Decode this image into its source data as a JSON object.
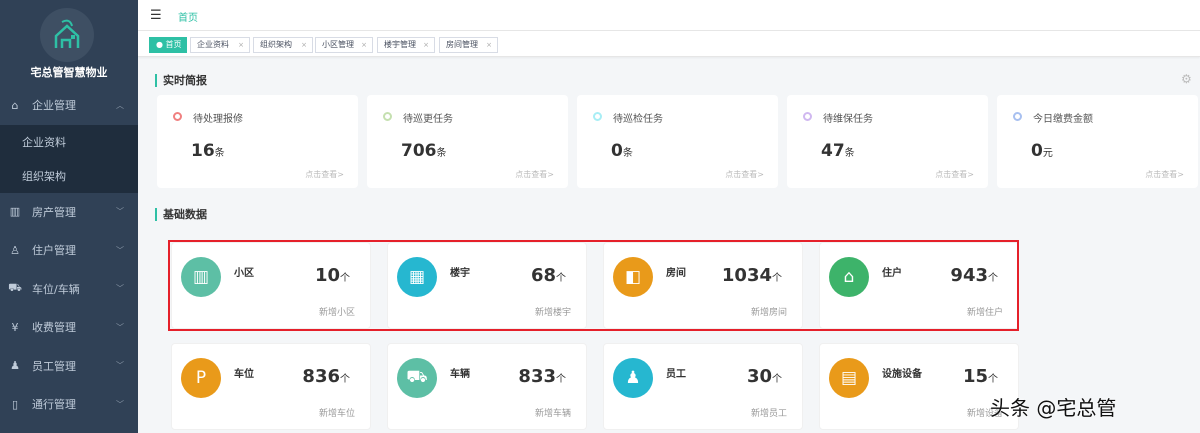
{
  "sidebar": {
    "brand": "宅总管智慧物业",
    "items": [
      {
        "label": "企业管理",
        "icon": "home-icon",
        "expanded": true
      },
      {
        "label": "房产管理",
        "icon": "building-icon"
      },
      {
        "label": "住户管理",
        "icon": "user-icon"
      },
      {
        "label": "车位/车辆",
        "icon": "car-icon"
      },
      {
        "label": "收费管理",
        "icon": "money-icon"
      },
      {
        "label": "员工管理",
        "icon": "staff-icon"
      },
      {
        "label": "通行管理",
        "icon": "door-icon"
      }
    ],
    "subitems": [
      "企业资料",
      "组织架构"
    ]
  },
  "header": {
    "breadcrumb": "首页"
  },
  "tabs": [
    {
      "label": "首页"
    },
    {
      "label": "企业资料"
    },
    {
      "label": "组织架构"
    },
    {
      "label": "小区管理"
    },
    {
      "label": "楼宇管理"
    },
    {
      "label": "房间管理"
    }
  ],
  "realtime": {
    "title": "实时简报",
    "link": "点击查看>",
    "cards": [
      {
        "label": "待处理报修",
        "value": "16",
        "unit": "条",
        "color": "#f08080"
      },
      {
        "label": "待巡更任务",
        "value": "706",
        "unit": "条",
        "color": "#c5e0b0"
      },
      {
        "label": "待巡检任务",
        "value": "0",
        "unit": "条",
        "color": "#a8eef5"
      },
      {
        "label": "待维保任务",
        "value": "47",
        "unit": "条",
        "color": "#d0b8f0"
      },
      {
        "label": "今日缴费金额",
        "value": "0",
        "unit": "元",
        "color": "#a8c0f0"
      }
    ]
  },
  "basic": {
    "title": "基础数据",
    "unit": "个",
    "cards": [
      {
        "name": "小区",
        "value": "10",
        "add": "新增小区",
        "color": "#5dbfa5",
        "icon": "community-icon",
        "glyph": "▥"
      },
      {
        "name": "楼宇",
        "value": "68",
        "add": "新增楼宇",
        "color": "#26b7d0",
        "icon": "building-icon",
        "glyph": "▦"
      },
      {
        "name": "房间",
        "value": "1034",
        "add": "新增房间",
        "color": "#e99a1a",
        "icon": "door-icon",
        "glyph": "◧"
      },
      {
        "name": "住户",
        "value": "943",
        "add": "新增住户",
        "color": "#3db36a",
        "icon": "house-user-icon",
        "glyph": "⌂"
      },
      {
        "name": "车位",
        "value": "836",
        "add": "新增车位",
        "color": "#e99a1a",
        "icon": "parking-icon",
        "glyph": "P"
      },
      {
        "name": "车辆",
        "value": "833",
        "add": "新增车辆",
        "color": "#5dbfa5",
        "icon": "car-icon",
        "glyph": "⛟"
      },
      {
        "name": "员工",
        "value": "30",
        "add": "新增员工",
        "color": "#26b7d0",
        "icon": "staff-icon",
        "glyph": "♟"
      },
      {
        "name": "设施设备",
        "value": "15",
        "add": "新增设备",
        "color": "#e99a1a",
        "icon": "equipment-icon",
        "glyph": "▤"
      }
    ]
  },
  "watermark": "头条 @宅总管"
}
